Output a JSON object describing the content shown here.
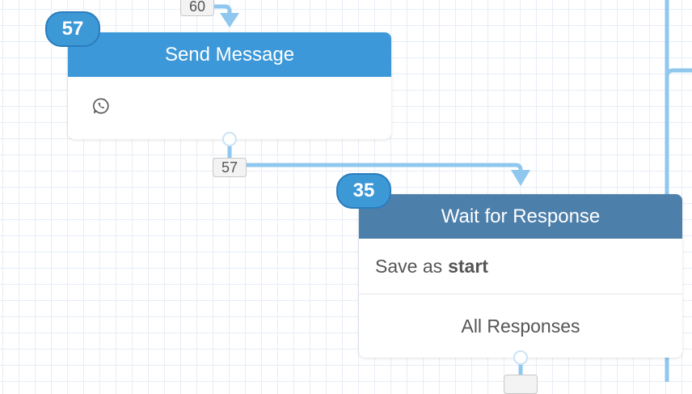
{
  "top_exit": {
    "count": "60"
  },
  "send_message_node": {
    "badge": "57",
    "title": "Send Message",
    "channel_icon": "whatsapp-icon",
    "header_color": "#3c98d9",
    "exit_count": "57"
  },
  "wait_node": {
    "badge": "35",
    "title": "Wait for Response",
    "header_color": "#4d7fab",
    "save_prefix": "Save as",
    "save_variable": "start",
    "category": "All Responses"
  },
  "colors": {
    "connector": "#8fc7ee",
    "badge": "#3d98d6",
    "grid": "#e6eef6"
  }
}
